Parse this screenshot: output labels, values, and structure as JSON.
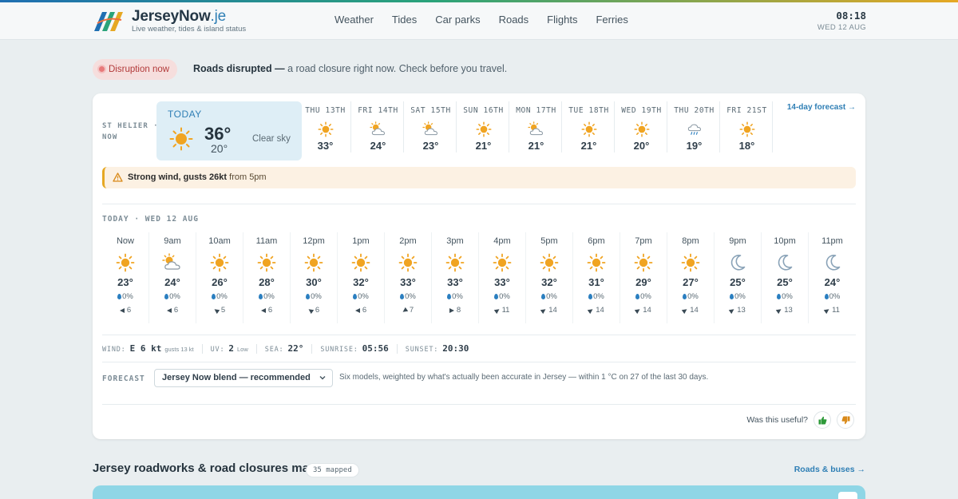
{
  "header": {
    "brand_name": "JerseyNow",
    "brand_tld": ".je",
    "tagline": "Live weather, tides & island status",
    "nav": [
      "Weather",
      "Tides",
      "Car parks",
      "Roads",
      "Flights",
      "Ferries"
    ],
    "time": "08:18",
    "date": "WED 12 AUG"
  },
  "disruption": {
    "badge": "Disruption now",
    "headline": "Roads disrupted —",
    "detail": " a road closure right now. Check before you travel."
  },
  "weather": {
    "location_line1": "ST HELIER ·",
    "location_line2": "NOW",
    "today": {
      "label": "TODAY",
      "high": "36°",
      "low": "20°",
      "condition": "Clear sky",
      "icon": "sun-icon"
    },
    "days": [
      {
        "name": "THU 13TH",
        "temp": "33°",
        "icon": "sun-icon"
      },
      {
        "name": "FRI 14TH",
        "temp": "24°",
        "icon": "partly-cloudy-icon"
      },
      {
        "name": "SAT 15TH",
        "temp": "23°",
        "icon": "partly-cloudy-icon"
      },
      {
        "name": "SUN 16TH",
        "temp": "21°",
        "icon": "sun-icon"
      },
      {
        "name": "MON 17TH",
        "temp": "21°",
        "icon": "partly-cloudy-icon"
      },
      {
        "name": "TUE 18TH",
        "temp": "21°",
        "icon": "sun-icon"
      },
      {
        "name": "WED 19TH",
        "temp": "20°",
        "icon": "sun-icon"
      },
      {
        "name": "THU 20TH",
        "temp": "19°",
        "icon": "rain-icon"
      },
      {
        "name": "FRI 21ST",
        "temp": "18°",
        "icon": "sun-icon"
      }
    ],
    "forecast_link": "14-day forecast →",
    "alert": {
      "bold": "Strong wind, gusts 26kt",
      "rest": " from 5pm"
    },
    "hourly_label": "TODAY · WED 12 AUG",
    "hours": [
      {
        "time": "Now",
        "icon": "sun-icon",
        "temp": "23°",
        "rain": "0%",
        "wind": "6",
        "wind_dir": "E"
      },
      {
        "time": "9am",
        "icon": "partly-cloudy-icon",
        "temp": "24°",
        "rain": "0%",
        "wind": "6",
        "wind_dir": "E"
      },
      {
        "time": "10am",
        "icon": "sun-icon",
        "temp": "26°",
        "rain": "0%",
        "wind": "5",
        "wind_dir": "NE"
      },
      {
        "time": "11am",
        "icon": "sun-icon",
        "temp": "28°",
        "rain": "0%",
        "wind": "6",
        "wind_dir": "E"
      },
      {
        "time": "12pm",
        "icon": "sun-icon",
        "temp": "30°",
        "rain": "0%",
        "wind": "6",
        "wind_dir": "NE"
      },
      {
        "time": "1pm",
        "icon": "sun-icon",
        "temp": "32°",
        "rain": "0%",
        "wind": "6",
        "wind_dir": "E"
      },
      {
        "time": "2pm",
        "icon": "sun-icon",
        "temp": "33°",
        "rain": "0%",
        "wind": "7",
        "wind_dir": "SE"
      },
      {
        "time": "3pm",
        "icon": "sun-icon",
        "temp": "33°",
        "rain": "0%",
        "wind": "8",
        "wind_dir": "W"
      },
      {
        "time": "4pm",
        "icon": "sun-icon",
        "temp": "33°",
        "rain": "0%",
        "wind": "11",
        "wind_dir": "SW"
      },
      {
        "time": "5pm",
        "icon": "sun-icon",
        "temp": "32°",
        "rain": "0%",
        "wind": "14",
        "wind_dir": "SW"
      },
      {
        "time": "6pm",
        "icon": "sun-icon",
        "temp": "31°",
        "rain": "0%",
        "wind": "14",
        "wind_dir": "SW"
      },
      {
        "time": "7pm",
        "icon": "sun-icon",
        "temp": "29°",
        "rain": "0%",
        "wind": "14",
        "wind_dir": "SW"
      },
      {
        "time": "8pm",
        "icon": "sun-icon",
        "temp": "27°",
        "rain": "0%",
        "wind": "14",
        "wind_dir": "SW"
      },
      {
        "time": "9pm",
        "icon": "moon-icon",
        "temp": "25°",
        "rain": "0%",
        "wind": "13",
        "wind_dir": "SW"
      },
      {
        "time": "10pm",
        "icon": "moon-icon",
        "temp": "25°",
        "rain": "0%",
        "wind": "13",
        "wind_dir": "SW"
      },
      {
        "time": "11pm",
        "icon": "moon-icon",
        "temp": "24°",
        "rain": "0%",
        "wind": "11",
        "wind_dir": "SW"
      }
    ],
    "stats": {
      "wind_label": "WIND:",
      "wind_value": "E 6 kt",
      "wind_gusts": "gusts 13 kt",
      "uv_label": "UV:",
      "uv_value": "2",
      "uv_level": "Low",
      "sea_label": "SEA:",
      "sea_value": "22°",
      "sunrise_label": "SUNRISE:",
      "sunrise_value": "05:56",
      "sunset_label": "SUNSET:",
      "sunset_value": "20:30"
    },
    "forecast": {
      "label": "FORECAST",
      "selected": "Jersey Now blend — recommended",
      "note": "Six models, weighted by what's actually been accurate in Jersey — within 1 °C on 27 of the last 30 days."
    },
    "feedback": "Was this useful?"
  },
  "map_section": {
    "title": "Jersey roadworks & road closures map",
    "badge": "35 mapped",
    "link": "Roads & buses →"
  },
  "colors": {
    "accent": "#2f7fb5",
    "sun": "#f0a422",
    "moon": "#8aa3b8",
    "alert_border": "#e6a823",
    "disruption": "#b23a3a"
  }
}
